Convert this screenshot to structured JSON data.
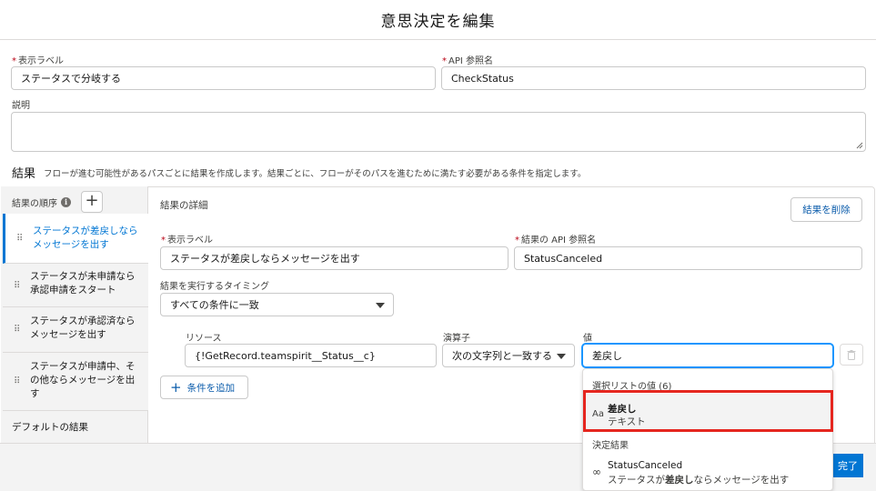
{
  "modal": {
    "title": "意思決定を編集"
  },
  "fields": {
    "label_label": "表示ラベル",
    "label_value": "ステータスで分岐する",
    "api_label": "API 参照名",
    "api_value": "CheckStatus",
    "required_mark": "*",
    "description_label": "説明",
    "description_value": ""
  },
  "outcomes": {
    "title": "結果",
    "description": "フローが進む可能性があるパスごとに結果を作成します。結果ごとに、フローがそのパスを進むために満たす必要がある条件を指定します。",
    "order_label": "結果の順序",
    "info_icon": "i",
    "add_icon": "+",
    "drag_icon": "⠿",
    "items": [
      {
        "label": "ステータスが差戻しならメッセージを出す",
        "line1": "ステータスが差戻しなら",
        "line2": "メッセージを出す",
        "active": true
      },
      {
        "label": "ステータスが未申請なら承認申請をスタート",
        "line1": "ステータスが未申請なら",
        "line2": "承認申請をスタート",
        "active": false
      },
      {
        "label": "ステータスが承認済ならメッセージを出す",
        "line1": "ステータスが承認済なら",
        "line2": "メッセージを出す",
        "active": false
      },
      {
        "label": "ステータスが申請中、その他ならメッセージを出す",
        "line1": "ステータスが申請中、そ",
        "line2": "の他ならメッセージを出",
        "line3": "す",
        "active": false
      }
    ],
    "default_label": "デフォルトの結果"
  },
  "detail": {
    "title": "結果の詳細",
    "delete_button": "結果を削除",
    "label_label": "表示ラベル",
    "label_value": "ステータスが差戻しならメッセージを出す",
    "api_label": "結果の API 参照名",
    "api_value": "StatusCanceled",
    "timing_label": "結果を実行するタイミング",
    "timing_value": "すべての条件に一致",
    "condition": {
      "resource_label": "リソース",
      "resource_value": "{!GetRecord.teamspirit__Status__c}",
      "operator_label": "演算子",
      "operator_value": "次の文字列と一致する",
      "value_label": "値",
      "value_value": "差戻し"
    },
    "add_condition_button": "条件を追加"
  },
  "dropdown": {
    "group1": "選択リストの値 (6)",
    "item1_main": "差戻し",
    "item1_sub": "テキスト",
    "item1_icon": "Aa",
    "group2": "決定結果",
    "item2_main": "StatusCanceled",
    "item2_sub_pre": "ステータスが",
    "item2_sub_bold": "差戻し",
    "item2_sub_post": "ならメッセージを出す",
    "item2_icon": "∞"
  },
  "footer": {
    "done_button": "完了"
  },
  "colors": {
    "brand": "#0176d3",
    "highlight_frame": "#e5261f"
  }
}
